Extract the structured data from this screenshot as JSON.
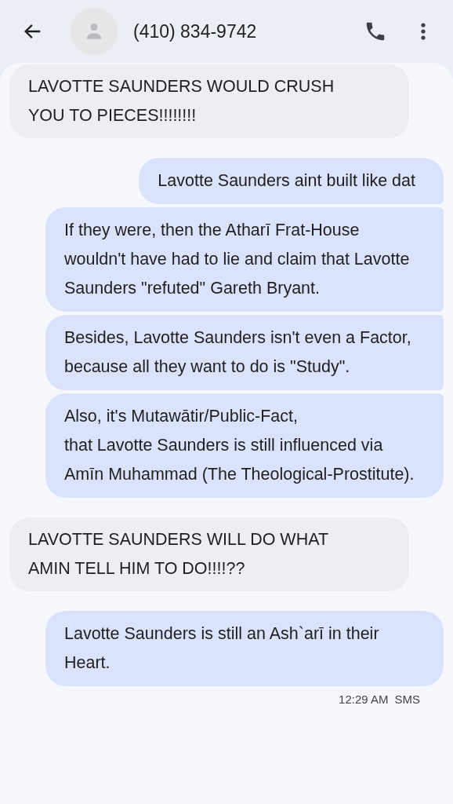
{
  "header": {
    "title": "(410) 834-9742"
  },
  "messages": [
    {
      "kind": "incoming",
      "text": "LAVOTTE SAUNDERS WOULD CRUSH YOU TO PIECES!!!!!!!!"
    },
    {
      "kind": "outgoing",
      "text": "Lavotte Saunders aint built like dat"
    },
    {
      "kind": "outgoing",
      "text": "If they were, then the Atharī Frat-House wouldn't have had to lie and claim that Lavotte Saunders \"refuted\" Gareth Bryant."
    },
    {
      "kind": "outgoing",
      "text": "Besides, Lavotte Saunders isn't even a Factor, because all they want to do is \"Study\"."
    },
    {
      "kind": "outgoing",
      "text": "Also, it's Mutawātir/Public-Fact,\nthat Lavotte Saunders is still influenced via Amīn Muhammad (The Theological-Prostitute)."
    },
    {
      "kind": "incoming",
      "text": "LAVOTTE SAUNDERS WILL DO WHAT AMIN TELL HIM TO DO!!!!??"
    },
    {
      "kind": "outgoing",
      "text": "Lavotte Saunders is still an Ash`arī in their Heart."
    }
  ],
  "footer": {
    "time": "12:29 AM",
    "type": "SMS"
  }
}
